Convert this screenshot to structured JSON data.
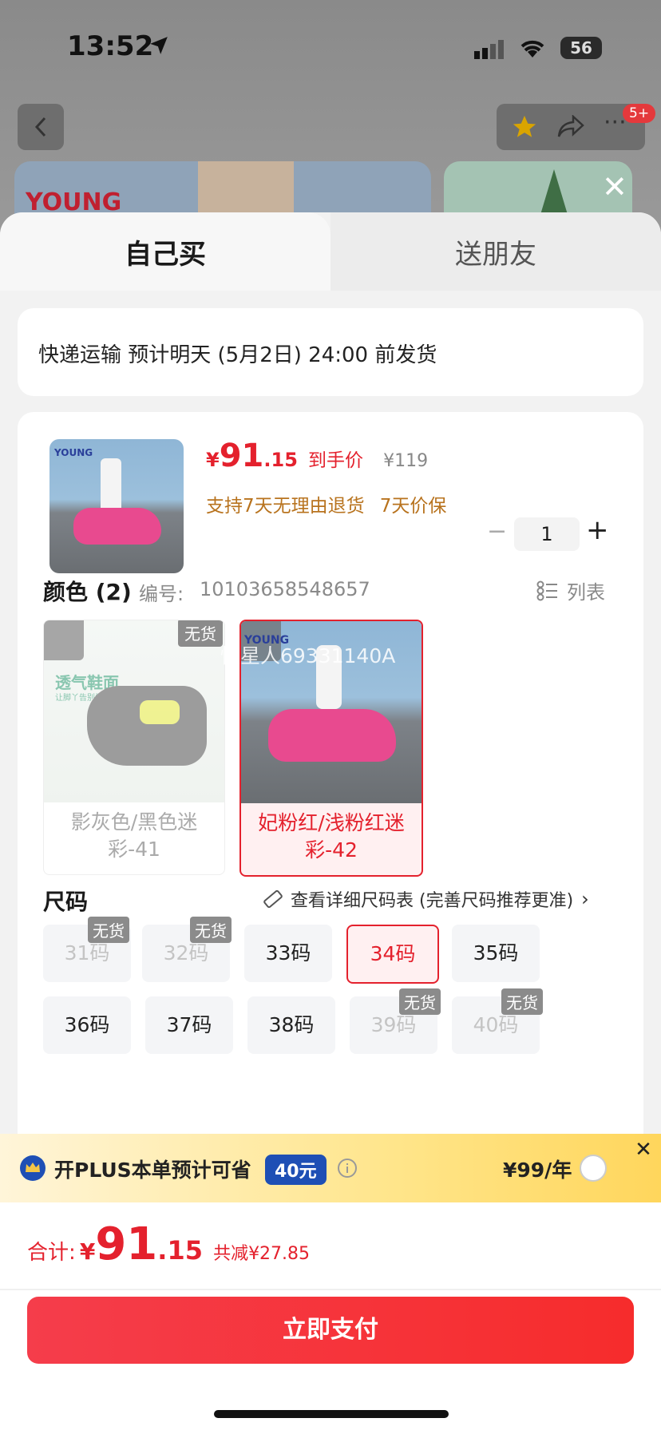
{
  "status_bar": {
    "time": "13:52",
    "battery": "56"
  },
  "background": {
    "notification_badge": "5+",
    "banner_brand": "YOUNG"
  },
  "tabs": [
    {
      "label": "自己买"
    },
    {
      "label": "送朋友"
    }
  ],
  "delivery": {
    "text": "快递运输 预计明天 (5月2日) 24:00 前发货"
  },
  "product": {
    "brand": "YOUNG",
    "price_symbol": "¥",
    "price_int": "91",
    "price_dec": ".15",
    "price_label": "到手价",
    "original_price": "¥119",
    "promo_1": "支持7天无理由退货",
    "promo_2": "7天价保",
    "quantity": "1",
    "qty_minus": "−",
    "qty_plus": "+"
  },
  "color_section": {
    "title": "颜色 (2)",
    "code_label": "编号:",
    "code": "10103658548657",
    "list_label": "列表",
    "watermark": "慢星人69331140A",
    "options": [
      {
        "label": "影灰色/黑色迷彩-41",
        "tag": "无货",
        "img_text": "透气鞋面",
        "img_sub": "让脚丫告别闷热",
        "selected": false,
        "available": false
      },
      {
        "label": "妃粉红/浅粉红迷彩-42",
        "tag": "",
        "img_text": "YOUNG",
        "selected": true,
        "available": true
      }
    ]
  },
  "size_section": {
    "title": "尺码",
    "chart_link": "查看详细尺码表 (完善尺码推荐更准)",
    "sizes": [
      {
        "label": "31码",
        "tag": "无货",
        "available": false,
        "selected": false
      },
      {
        "label": "32码",
        "tag": "无货",
        "available": false,
        "selected": false
      },
      {
        "label": "33码",
        "tag": "",
        "available": true,
        "selected": false
      },
      {
        "label": "34码",
        "tag": "",
        "available": true,
        "selected": true
      },
      {
        "label": "35码",
        "tag": "",
        "available": true,
        "selected": false
      },
      {
        "label": "36码",
        "tag": "",
        "available": true,
        "selected": false
      },
      {
        "label": "37码",
        "tag": "",
        "available": true,
        "selected": false
      },
      {
        "label": "38码",
        "tag": "",
        "available": true,
        "selected": false
      },
      {
        "label": "39码",
        "tag": "无货",
        "available": false,
        "selected": false
      },
      {
        "label": "40码",
        "tag": "无货",
        "available": false,
        "selected": false
      }
    ]
  },
  "plus_bar": {
    "text": "开PLUS本单预计可省",
    "save_amount": "40元",
    "price": "¥99/年"
  },
  "footer": {
    "total_label": "合计:",
    "symbol": "¥",
    "total_int": "91",
    "total_dec": ".15",
    "discount": "共减¥27.85",
    "pay_button": "立即支付"
  },
  "colors": {
    "accent": "#e4212d",
    "promo": "#b8731e",
    "plus_blue": "#1e4fb5"
  }
}
